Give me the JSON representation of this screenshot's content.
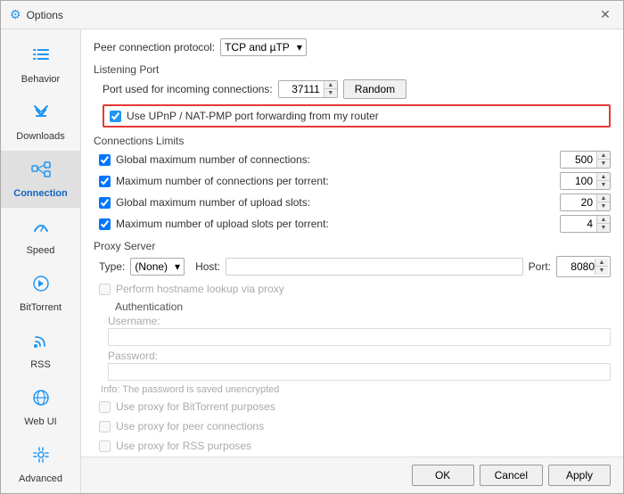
{
  "window": {
    "title": "Options",
    "close_button": "✕"
  },
  "sidebar": {
    "items": [
      {
        "id": "behavior",
        "label": "Behavior",
        "icon": "≡",
        "active": false
      },
      {
        "id": "downloads",
        "label": "Downloads",
        "icon": "↓",
        "active": false
      },
      {
        "id": "connection",
        "label": "Connection",
        "icon": "⊞",
        "active": true
      },
      {
        "id": "speed",
        "label": "Speed",
        "icon": "⚡",
        "active": false
      },
      {
        "id": "bittorrent",
        "label": "BitTorrent",
        "icon": "⊙",
        "active": false
      },
      {
        "id": "rss",
        "label": "RSS",
        "icon": "◌",
        "active": false
      },
      {
        "id": "webui",
        "label": "Web UI",
        "icon": "⊕",
        "active": false
      },
      {
        "id": "advanced",
        "label": "Advanced",
        "icon": "✦",
        "active": false
      }
    ]
  },
  "main": {
    "protocol_label": "Peer connection protocol:",
    "protocol_value": "TCP and µTP",
    "listening_port_section": "Listening Port",
    "port_label": "Port used for incoming connections:",
    "port_value": "37111",
    "random_button": "Random",
    "upnp_label": "Use UPnP / NAT-PMP port forwarding from my router",
    "connections_section": "Connections Limits",
    "conn_items": [
      {
        "label": "Global maximum number of connections:",
        "value": "500",
        "checked": true
      },
      {
        "label": "Maximum number of connections per torrent:",
        "value": "100",
        "checked": true
      },
      {
        "label": "Global maximum number of upload slots:",
        "value": "20",
        "checked": true
      },
      {
        "label": "Maximum number of upload slots per torrent:",
        "value": "4",
        "checked": true
      }
    ],
    "proxy_section": "Proxy Server",
    "proxy_type_label": "Type:",
    "proxy_type_value": "(None)",
    "proxy_host_label": "Host:",
    "proxy_host_placeholder": "",
    "proxy_port_label": "Port:",
    "proxy_port_value": "8080",
    "hostname_lookup_label": "Perform hostname lookup via proxy",
    "auth_header": "Authentication",
    "username_label": "Username:",
    "password_label": "Password:",
    "info_text": "Info: The password is saved unencrypted",
    "use_proxy_bittorrent_label": "Use proxy for BitTorrent purposes",
    "use_proxy_peer_label": "Use proxy for peer connections",
    "use_proxy_rss_label": "Use proxy for RSS purposes"
  },
  "footer": {
    "ok_label": "OK",
    "cancel_label": "Cancel",
    "apply_label": "Apply"
  }
}
